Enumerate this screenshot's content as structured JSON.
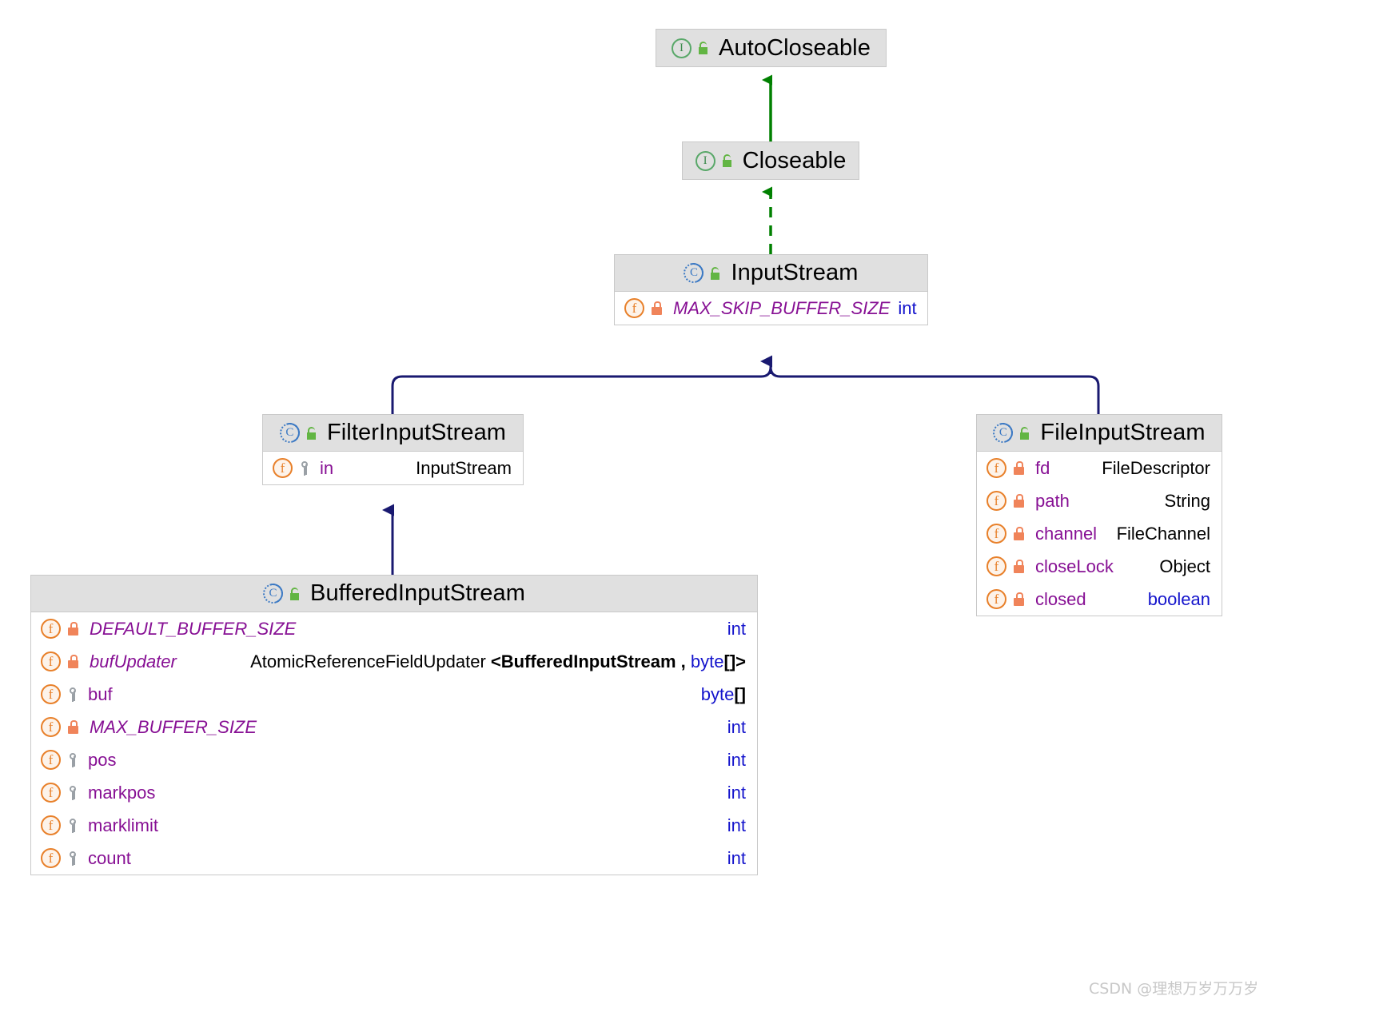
{
  "diagram": {
    "kind": "uml-class-hierarchy",
    "colors": {
      "inheritance_solid": "#191970",
      "realization_dashed": "#008000",
      "header_bg": "#e0e0e0",
      "box_border": "#c9c9c9",
      "field_name": "#871094",
      "keyword_type": "#1414cc",
      "icon_public": "#62b543",
      "icon_private": "#f0845a",
      "icon_protected": "#9aa0a6",
      "icon_interface": "#59a869",
      "icon_class": "#3b79c4",
      "watermark": "#c8c8c8"
    },
    "classes": [
      {
        "id": "auto-closeable",
        "name": "AutoCloseable",
        "stereotype_icon": "interface-icon",
        "stereotype_letter": "I",
        "visibility_icon": "public-unlocked-icon",
        "fields": []
      },
      {
        "id": "closeable",
        "name": "Closeable",
        "stereotype_icon": "interface-icon",
        "stereotype_letter": "I",
        "visibility_icon": "public-unlocked-icon",
        "fields": []
      },
      {
        "id": "input-stream",
        "name": "InputStream",
        "stereotype_icon": "class-icon",
        "stereotype_letter": "C",
        "visibility_icon": "public-unlocked-icon",
        "fields": [
          {
            "name": "MAX_SKIP_BUFFER_SIZE",
            "visibility_icon": "private-lock-icon",
            "member_icon": "field-icon",
            "static_final": true,
            "type_parts": [
              {
                "text": "int",
                "style": "keyword"
              }
            ]
          }
        ]
      },
      {
        "id": "filter-input-stream",
        "name": "FilterInputStream",
        "stereotype_icon": "class-icon",
        "stereotype_letter": "C",
        "visibility_icon": "public-unlocked-icon",
        "fields": [
          {
            "name": "in",
            "visibility_icon": "protected-key-icon",
            "member_icon": "field-icon",
            "static_final": false,
            "type_parts": [
              {
                "text": "InputStream",
                "style": "plain"
              }
            ]
          }
        ]
      },
      {
        "id": "file-input-stream",
        "name": "FileInputStream",
        "stereotype_icon": "class-icon",
        "stereotype_letter": "C",
        "visibility_icon": "public-unlocked-icon",
        "fields": [
          {
            "name": "fd",
            "visibility_icon": "private-lock-icon",
            "member_icon": "field-icon",
            "static_final": false,
            "type_parts": [
              {
                "text": "FileDescriptor",
                "style": "plain"
              }
            ]
          },
          {
            "name": "path",
            "visibility_icon": "private-lock-icon",
            "member_icon": "field-icon",
            "static_final": false,
            "type_parts": [
              {
                "text": "String",
                "style": "plain"
              }
            ]
          },
          {
            "name": "channel",
            "visibility_icon": "private-lock-icon",
            "member_icon": "field-icon",
            "static_final": false,
            "type_parts": [
              {
                "text": "FileChannel",
                "style": "plain"
              }
            ]
          },
          {
            "name": "closeLock",
            "visibility_icon": "private-lock-icon",
            "member_icon": "field-icon",
            "static_final": false,
            "type_parts": [
              {
                "text": "Object",
                "style": "plain"
              }
            ]
          },
          {
            "name": "closed",
            "visibility_icon": "private-lock-icon",
            "member_icon": "field-icon",
            "static_final": false,
            "type_parts": [
              {
                "text": "boolean",
                "style": "keyword"
              }
            ]
          }
        ]
      },
      {
        "id": "buffered-input-stream",
        "name": "BufferedInputStream",
        "stereotype_icon": "class-icon",
        "stereotype_letter": "C",
        "visibility_icon": "public-unlocked-icon",
        "fields": [
          {
            "name": "DEFAULT_BUFFER_SIZE",
            "visibility_icon": "private-lock-icon",
            "member_icon": "field-icon",
            "static_final": true,
            "type_parts": [
              {
                "text": "int",
                "style": "keyword"
              }
            ]
          },
          {
            "name": "bufUpdater",
            "visibility_icon": "private-lock-icon",
            "member_icon": "field-icon",
            "static_final": true,
            "type_parts": [
              {
                "text": "AtomicReferenceFieldUpdater ",
                "style": "plain"
              },
              {
                "text": "<BufferedInputStream , ",
                "style": "bracket"
              },
              {
                "text": "byte",
                "style": "keyword"
              },
              {
                "text": "[]>",
                "style": "bracket"
              }
            ]
          },
          {
            "name": "buf",
            "visibility_icon": "protected-key-icon",
            "member_icon": "field-icon",
            "static_final": false,
            "type_parts": [
              {
                "text": "byte",
                "style": "keyword"
              },
              {
                "text": "[]",
                "style": "bracket"
              }
            ]
          },
          {
            "name": "MAX_BUFFER_SIZE",
            "visibility_icon": "private-lock-icon",
            "member_icon": "field-icon",
            "static_final": true,
            "type_parts": [
              {
                "text": "int",
                "style": "keyword"
              }
            ]
          },
          {
            "name": "pos",
            "visibility_icon": "protected-key-icon",
            "member_icon": "field-icon",
            "static_final": false,
            "type_parts": [
              {
                "text": "int",
                "style": "keyword"
              }
            ]
          },
          {
            "name": "markpos",
            "visibility_icon": "protected-key-icon",
            "member_icon": "field-icon",
            "static_final": false,
            "type_parts": [
              {
                "text": "int",
                "style": "keyword"
              }
            ]
          },
          {
            "name": "marklimit",
            "visibility_icon": "protected-key-icon",
            "member_icon": "field-icon",
            "static_final": false,
            "type_parts": [
              {
                "text": "int",
                "style": "keyword"
              }
            ]
          },
          {
            "name": "count",
            "visibility_icon": "protected-key-icon",
            "member_icon": "field-icon",
            "static_final": false,
            "type_parts": [
              {
                "text": "int",
                "style": "keyword"
              }
            ]
          }
        ]
      }
    ],
    "relations": [
      {
        "from": "Closeable",
        "to": "AutoCloseable",
        "type": "inheritance",
        "line": "solid",
        "color": "#008000"
      },
      {
        "from": "InputStream",
        "to": "Closeable",
        "type": "realization",
        "line": "dashed",
        "color": "#008000"
      },
      {
        "from": "FilterInputStream",
        "to": "InputStream",
        "type": "inheritance",
        "line": "solid",
        "color": "#191970"
      },
      {
        "from": "FileInputStream",
        "to": "InputStream",
        "type": "inheritance",
        "line": "solid",
        "color": "#191970"
      },
      {
        "from": "BufferedInputStream",
        "to": "FilterInputStream",
        "type": "inheritance",
        "line": "solid",
        "color": "#191970"
      }
    ]
  },
  "watermark": {
    "text": "CSDN @理想万岁万万岁"
  }
}
